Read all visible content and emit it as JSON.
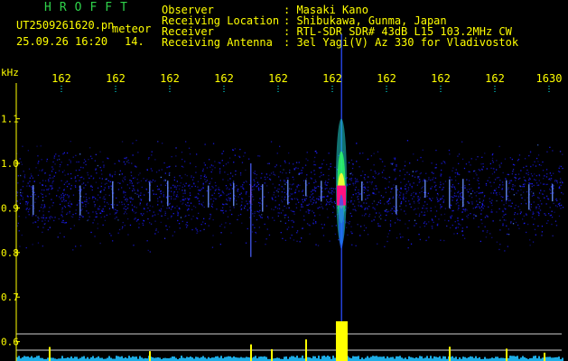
{
  "station_logo": "HROFFT",
  "file_name": "UT2509261620.pn",
  "image_type": "meteor",
  "date_time": "25.09.26 16:20",
  "frame_index": "14.",
  "info": [
    {
      "label": "Observer",
      "value": ": Masaki Kano"
    },
    {
      "label": "Receiving Location",
      "value": ": Shibukawa, Gunma, Japan"
    },
    {
      "label": "Receiver",
      "value": ": RTL-SDR SDR# 43dB L15 103.2MHz CW"
    },
    {
      "label": "Receiving Antenna",
      "value": ": 3el Yagi(V) Az 330 for Vladivostok"
    }
  ],
  "chart_data": {
    "type": "heatmap",
    "ylabel": "kHz",
    "x_tick_labels": [
      "162",
      "162",
      "162",
      "162",
      "162",
      "162",
      "162",
      "162",
      "162",
      "1630"
    ],
    "y_tick_labels": [
      "1.1",
      "1.0",
      "0.9",
      "0.8",
      "0.7",
      "0.6"
    ],
    "y_ticks": [
      1.1,
      1.0,
      0.9,
      0.8,
      0.7,
      0.6
    ],
    "band_center_khz": 0.93,
    "meteor_echo": {
      "x_fraction": 0.595,
      "peak_khz": 0.93,
      "extent_khz": [
        0.56,
        1.29
      ]
    },
    "colors": {
      "background": "#000000",
      "labels": "#ffff00",
      "logo": "#2fd24a",
      "ticks": "#00ffff",
      "noise": "#1c1cff",
      "echo_peak": "#ff1080"
    }
  }
}
